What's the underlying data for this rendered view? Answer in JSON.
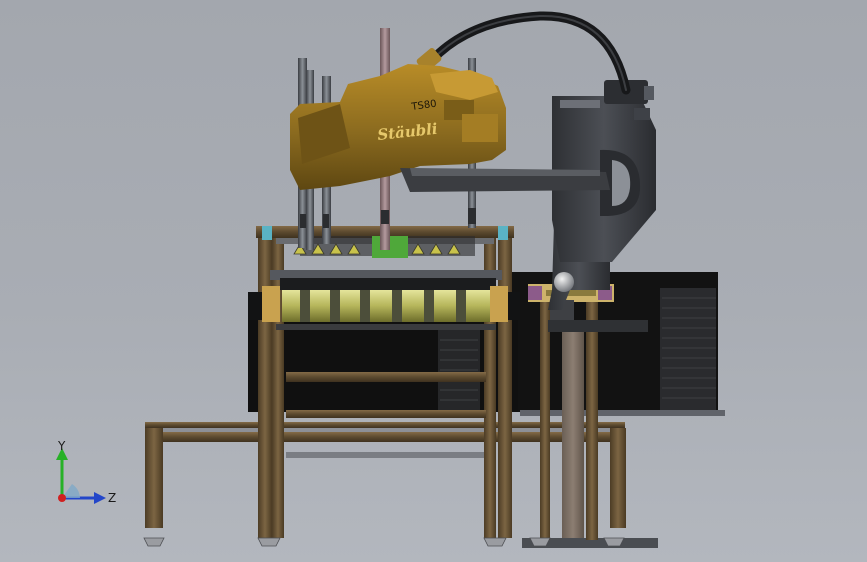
{
  "scene": {
    "robot_model_label": "TS80",
    "robot_brand_label": "Stäubli",
    "triad_y_label": "Y",
    "triad_z_label": "Z"
  },
  "colors": {
    "viewport_background": "#a7abb2",
    "robot_gold": "#8a6a1f",
    "robot_gold_dark": "#5e4711",
    "robot_body_dark": "#3d3f43",
    "frame_brown": "#6f5a3a",
    "roller_yellow": "#bfbf63",
    "cabinet_black": "#121212",
    "axis_y_green": "#27b127",
    "axis_z_blue": "#2346c9",
    "axis_origin_red": "#d02020"
  }
}
